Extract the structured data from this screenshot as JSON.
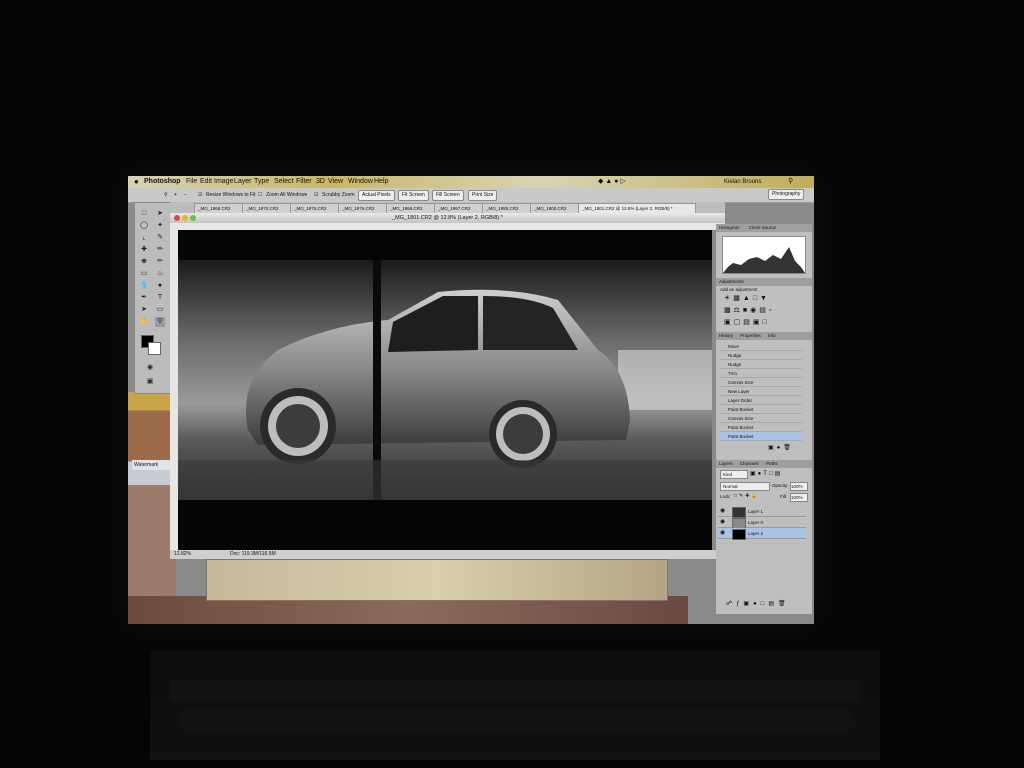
{
  "menubar": {
    "apple": "",
    "app_name": "Photoshop",
    "items": [
      "File",
      "Edit",
      "Image",
      "Layer",
      "Type",
      "Select",
      "Filter",
      "3D",
      "View",
      "Window",
      "Help"
    ],
    "right_user": "Kielan Brouns",
    "workspace": "Photography"
  },
  "options_bar": {
    "resize_windows": "Resize Windows to Fit",
    "zoom_all": "Zoom All Windows",
    "scrubby": "Scrubby Zoom",
    "actual_pixels": "Actual Pixels",
    "fit_screen": "Fit Screen",
    "fill_screen": "Fill Screen",
    "print_size": "Print Size"
  },
  "tabs": [
    "_MG_1968.CR2",
    "_MG_1970.CR2",
    "_MG_1975.CR2",
    "_MG_1976.CR2",
    "_MG_1966.CR2",
    "_MG_1967.CR2",
    "_MG_1985.CR2",
    "_MG_1800.CR2",
    "_MG_1801.CR2 @ 12.8% (Layer 2, RGB/8) *"
  ],
  "document": {
    "title": "_MG_1801.CR2 @ 12.8% (Layer 2, RGB/8) *",
    "zoom": "12.82%",
    "doc_size": "Doc: 119.3M/116.5M"
  },
  "panels": {
    "histogram_tab": "Histogram",
    "navigator_tab": "Navigator",
    "info_tab": "Clone Source",
    "adjustments_tab": "Adjustments",
    "adjustments_subtitle": "Add an adjustment",
    "history_tab": "History",
    "properties_tab": "Properties",
    "info2_tab": "Info",
    "history_items": [
      "Move",
      "Nudge",
      "Nudge",
      "Trim",
      "Canvas Size",
      "New Layer",
      "Layer Order",
      "Paint Bucket",
      "Canvas Size",
      "Paint Bucket",
      "Paint Bucket"
    ],
    "layers_tab": "Layers",
    "channels_tab": "Channels",
    "paths_tab": "Paths",
    "kind_label": "Kind",
    "blend_mode": "Normal",
    "opacity_label": "Opacity:",
    "opacity_value": "100%",
    "lock_label": "Lock:",
    "fill_label": "Fill:",
    "fill_value": "100%",
    "layers": [
      "Layer 1",
      "Layer 0",
      "Layer 2"
    ]
  },
  "desktop": {
    "watermark_label": "Watermark"
  },
  "colors": {
    "menubar_gold": "#c9b766",
    "panel_gray": "#bfbfbf",
    "selected_row": "#a9c3e6"
  }
}
